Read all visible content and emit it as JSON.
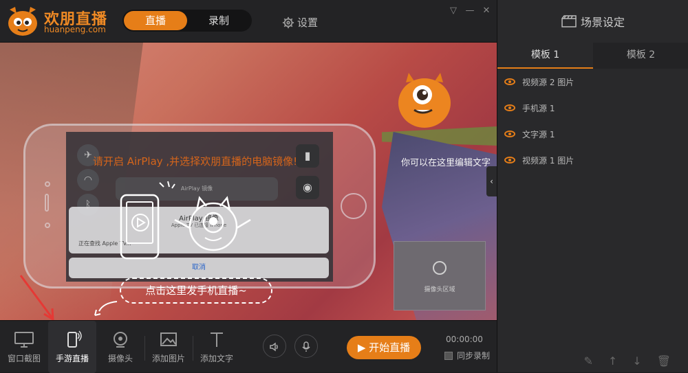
{
  "brand": {
    "name": "欢朋直播",
    "domain": "huanpeng.com",
    "accent": "#e67e18"
  },
  "mode_switch": {
    "live_label": "直播",
    "record_label": "录制",
    "active": "直播"
  },
  "settings_label": "设置",
  "window_controls": {
    "dropdown": "▽",
    "minimize": "—",
    "close": "✕"
  },
  "preview": {
    "prompt": "请开启 AirPlay ,并选择欢朋直播的电脑镜像!",
    "side_note": "你可以在这里编辑文字",
    "camera_area_label": "摄像头区域",
    "hint": "点击这里发手机直播~",
    "ios": {
      "airplay_bar": "AirPlay 镜像",
      "airplay_title": "AirPlay 镜像",
      "airplay_subtitle": "Apple TV 已连接 iPhone",
      "searching": "正在查找 Apple TV...",
      "cancel": "取消"
    }
  },
  "toolbar": {
    "window_capture": "窗口截图",
    "mobile_live": "手游直播",
    "camera": "摄像头",
    "add_image": "添加图片",
    "add_text": "添加文字",
    "start_live": "开始直播",
    "timer": "00:00:00",
    "sync_record": "同步录制"
  },
  "right_panel": {
    "title": "场景设定",
    "tabs": [
      "模板 1",
      "模板 2"
    ],
    "active_tab": "模板 1",
    "sources": [
      "视频源 2 图片",
      "手机源 1",
      "文字源 1",
      "视频源 1 图片"
    ]
  }
}
